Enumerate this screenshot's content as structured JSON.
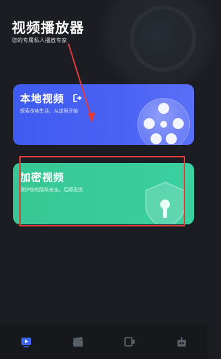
{
  "header": {
    "title": "视频播放器",
    "subtitle": "您的专属私人播放专家"
  },
  "cards": [
    {
      "title": "本地视频",
      "description": "探索本地生活，从这里开始",
      "color": "#4a62f4",
      "icon": "film-reel-icon"
    },
    {
      "title": "加密视频",
      "description": "保护你的隐私安全，后顾无忧",
      "color": "#3bd0a0",
      "icon": "shield-lock-icon"
    }
  ],
  "nav": [
    {
      "icon": "play-video-icon",
      "active": true
    },
    {
      "icon": "clapperboard-icon",
      "active": false
    },
    {
      "icon": "screen-cast-icon",
      "active": false
    },
    {
      "icon": "robot-icon",
      "active": false
    }
  ],
  "colors": {
    "accent": "#4a62f4",
    "annotation": "#e23b3b"
  }
}
